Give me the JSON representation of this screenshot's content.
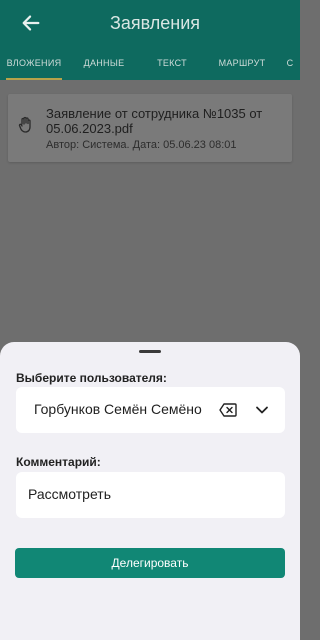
{
  "app_bar": {
    "title": "Заявления",
    "back_icon": "arrow-left-icon"
  },
  "tabs": [
    {
      "label": "ВЛОЖЕНИЯ",
      "active": true
    },
    {
      "label": "ДАННЫЕ",
      "active": false
    },
    {
      "label": "ТЕКСТ",
      "active": false
    },
    {
      "label": "МАРШРУТ",
      "active": false
    },
    {
      "label": "С",
      "active": false
    }
  ],
  "attachment": {
    "icon": "hand-document-icon",
    "name": "Заявление от сотрудника №1035 от 05.06.2023.pdf",
    "meta": "Автор: Система. Дата: 05.06.23 08:01"
  },
  "sheet": {
    "user_label": "Выберите пользователя:",
    "user_value": "Горбунков Семён Семёно",
    "clear_icon": "backspace-clear-icon",
    "dropdown_icon": "chevron-down-icon",
    "comment_label": "Комментарий:",
    "comment_value": "Рассмотреть",
    "submit_label": "Делегировать"
  },
  "colors": {
    "primary": "#0e6a5f",
    "button": "#118775",
    "tab_indicator": "#b7a24a",
    "sheet_bg": "#f1f0f5",
    "overlay": "#6e6e6e"
  }
}
